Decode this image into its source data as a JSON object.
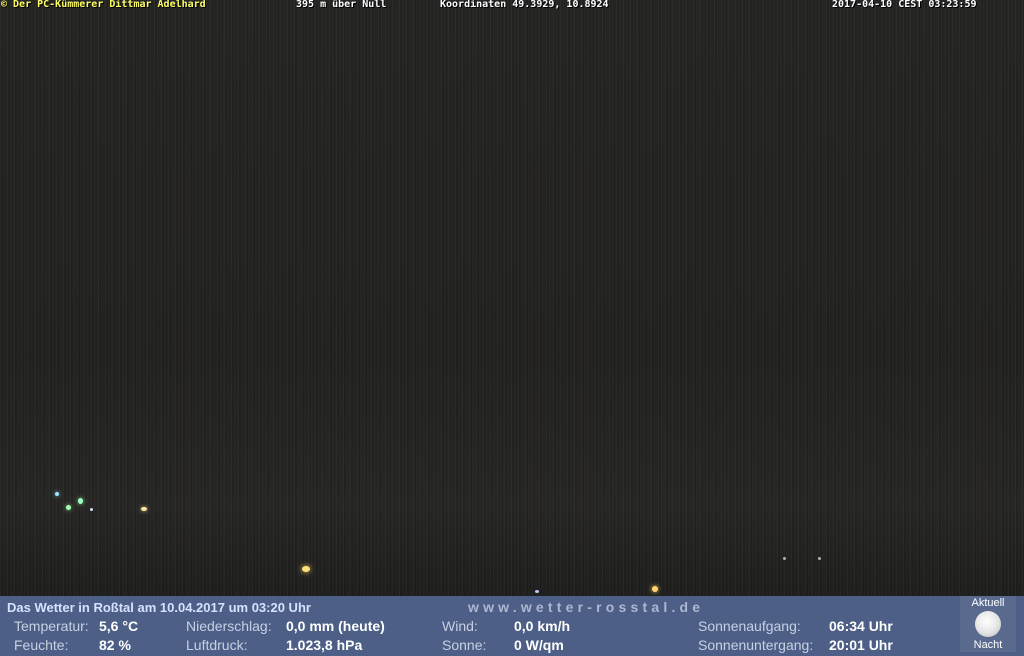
{
  "overlay": {
    "copyright": "© Der PC-Kümmerer Dittmar Adelhard",
    "altitude": "395 m über Null",
    "coordinates": "Koordinaten 49.3929, 10.8924",
    "timestamp": "2017-04-10 CEST 03:23:59"
  },
  "weather": {
    "title": "Das Wetter in Roßtal am 10.04.2017 um 03:20 Uhr",
    "url": "www.wetter-rosstal.de",
    "temperature_label": "Temperatur:",
    "temperature_value": "5,6 °C",
    "humidity_label": "Feuchte:",
    "humidity_value": "82 %",
    "precip_label": "Niederschlag:",
    "precip_value": "0,0 mm (heute)",
    "pressure_label": "Luftdruck:",
    "pressure_value": "1.023,8 hPa",
    "wind_label": "Wind:",
    "wind_value": "0,0 km/h",
    "sun_label": "Sonne:",
    "sun_value": "0 W/qm",
    "sunrise_label": "Sonnenaufgang:",
    "sunrise_value": "06:34 Uhr",
    "sunset_label": "Sonnenuntergang:",
    "sunset_value": "20:01 Uhr",
    "moon_top": "Aktuell",
    "moon_bottom": "Nacht"
  },
  "icons": {
    "moon": "full-moon-icon"
  },
  "colors": {
    "bar_background": "#4d5f86",
    "overlay_yellow": "#ffff66",
    "overlay_white": "#ffffff"
  }
}
